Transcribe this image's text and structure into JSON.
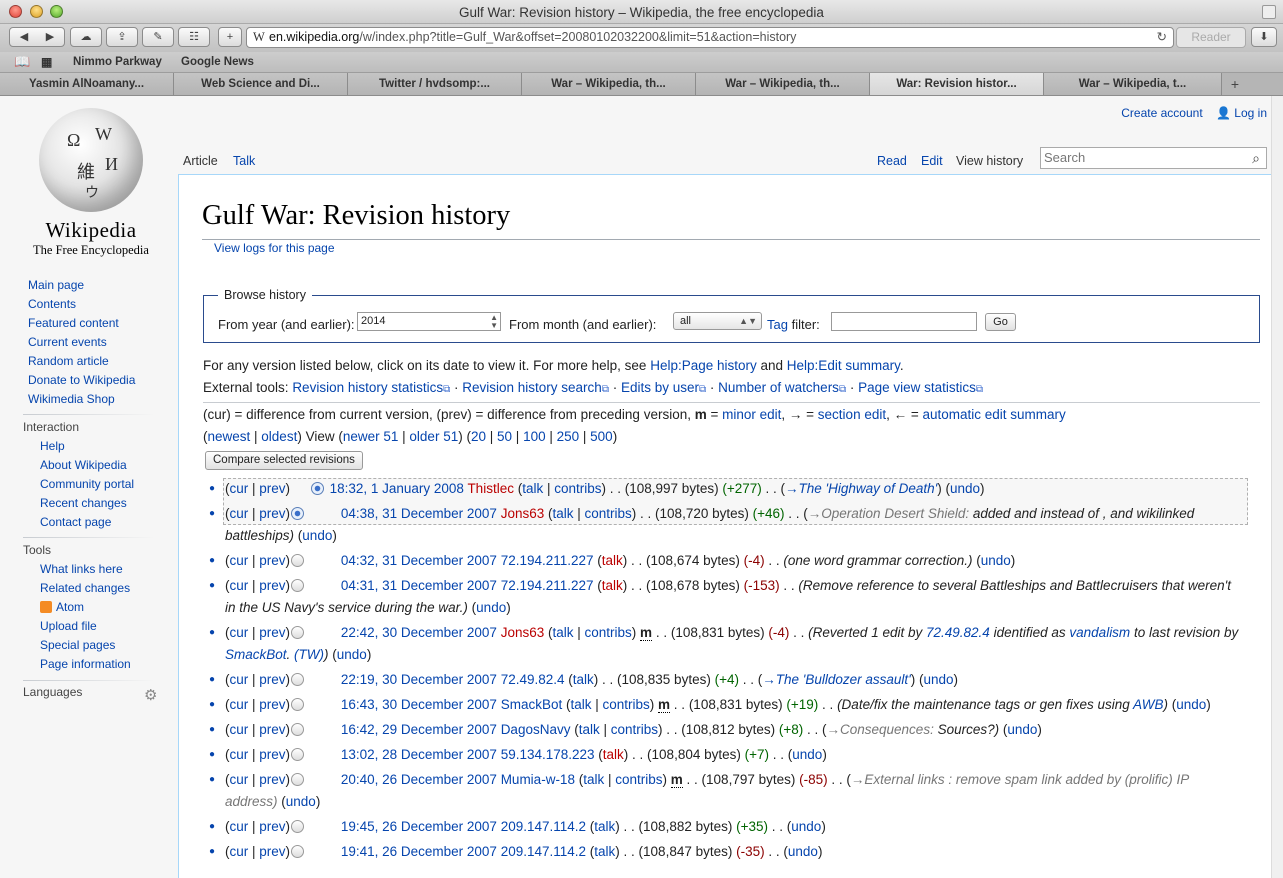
{
  "window": {
    "title": "Gulf War: Revision history – Wikipedia, the free encyclopedia"
  },
  "toolbar": {
    "url_host": "en.wikipedia.org",
    "url_path": "/w/index.php?title=Gulf_War&offset=20080102032200&limit=51&action=history",
    "reader_label": "Reader"
  },
  "bookmarks": [
    "Nimmo Parkway",
    "Google News"
  ],
  "tabs": [
    {
      "label": "Yasmin AlNoamany..."
    },
    {
      "label": "Web Science and Di..."
    },
    {
      "label": "Twitter / hvdsomp:..."
    },
    {
      "label": "War – Wikipedia, th..."
    },
    {
      "label": "War – Wikipedia, th..."
    },
    {
      "label": "War: Revision histor..."
    },
    {
      "label": "War – Wikipedia, t..."
    }
  ],
  "logo": {
    "title": "Wikipedia",
    "subtitle": "The Free Encyclopedia"
  },
  "personal": {
    "create": "Create account",
    "login": "Log in"
  },
  "nav": [
    "Main page",
    "Contents",
    "Featured content",
    "Current events",
    "Random article",
    "Donate to Wikipedia",
    "Wikimedia Shop"
  ],
  "interaction": {
    "heading": "Interaction",
    "items": [
      "Help",
      "About Wikipedia",
      "Community portal",
      "Recent changes",
      "Contact page"
    ]
  },
  "tools": {
    "heading": "Tools",
    "items": [
      "What links here",
      "Related changes",
      "Atom",
      "Upload file",
      "Special pages",
      "Page information"
    ]
  },
  "languages": {
    "heading": "Languages"
  },
  "ctabs": {
    "article": "Article",
    "talk": "Talk",
    "read": "Read",
    "edit": "Edit",
    "history": "View history"
  },
  "search": {
    "placeholder": "Search"
  },
  "heading": "Gulf War: Revision history",
  "viewlogs": "View logs for this page",
  "browse": {
    "legend": "Browse history",
    "year_label": "From year (and earlier):",
    "year_value": "2014",
    "month_label": "From month (and earlier):",
    "month_value": "all",
    "tag_link": "Tag",
    "tag_label": "filter:",
    "go": "Go"
  },
  "help": {
    "pre": "For any version listed below, click on its date to view it. For more help, see ",
    "link1": "Help:Page history",
    "mid": " and ",
    "link2": "Help:Edit summary",
    "post": "."
  },
  "external": {
    "label": "External tools:",
    "items": [
      "Revision history statistics",
      "Revision history search",
      "Edits by user",
      "Number of watchers",
      "Page view statistics"
    ]
  },
  "legend": {
    "a": "(cur) = difference from current version, (prev) = difference from preceding version, ",
    "m": "m",
    "eq": " = ",
    "minor": "minor edit",
    "arrow": ", → = ",
    "section": "section edit",
    "arrow2": ", ← = ",
    "auto": "automatic edit summary"
  },
  "paging": {
    "newest": "newest",
    "oldest": "oldest",
    "view": "View",
    "newer": "newer 51",
    "older": "older 51",
    "n20": "20",
    "n50": "50",
    "n100": "100",
    "n250": "250",
    "n500": "500"
  },
  "compare_label": "Compare selected revisions",
  "revisions": [
    {
      "cur": "cur",
      "prev": "prev",
      "date": "18:32, 1 January 2008",
      "user": "Thistlec",
      "talk": "talk",
      "contribs": "contribs",
      "bytes": "(108,997 bytes)",
      "diff": "(+277)",
      "comment": "→The 'Highway of Death'",
      "undo": "undo"
    },
    {
      "cur": "cur",
      "prev": "prev",
      "date": "04:38, 31 December 2007",
      "user": "Jons63",
      "talk": "talk",
      "contribs": "contribs",
      "bytes": "(108,720 bytes)",
      "diff": "(+46)",
      "comment_sec": "→Operation Desert Shield:",
      "comment": "added and instead of , and wikilinked",
      "comment2": "battleships)",
      "undo": "undo"
    },
    {
      "cur": "cur",
      "prev": "prev",
      "date": "04:32, 31 December 2007",
      "user": "72.194.211.227",
      "talk": "talk",
      "bytes": "(108,674 bytes)",
      "diff": "(-4)",
      "comment": "(one word grammar correction.)",
      "undo": "undo"
    },
    {
      "cur": "cur",
      "prev": "prev",
      "date": "04:31, 31 December 2007",
      "user": "72.194.211.227",
      "talk": "talk",
      "bytes": "(108,678 bytes)",
      "diff": "(-153)",
      "comment": "(Remove reference to several Battleships and Battlecruisers that weren't",
      "comment2": "in the US Navy's service during the war.)",
      "undo": "undo"
    },
    {
      "cur": "cur",
      "prev": "prev",
      "date": "22:42, 30 December 2007",
      "user": "Jons63",
      "talk": "talk",
      "contribs": "contribs",
      "minor": "m",
      "bytes": "(108,831 bytes)",
      "diff": "(-4)",
      "comment": "(Reverted 1 edit by",
      "ip": "72.49.82.4",
      "comment_mid": "identified as",
      "vandal": "vandalism",
      "comment_end": "to last revision by",
      "bot": "SmackBot",
      "tw": "(TW)",
      "undo": "undo"
    },
    {
      "cur": "cur",
      "prev": "prev",
      "date": "22:19, 30 December 2007",
      "user": "72.49.82.4",
      "talk": "talk",
      "bytes": "(108,835 bytes)",
      "diff": "(+4)",
      "comment": "→The 'Bulldozer assault'",
      "undo": "undo"
    },
    {
      "cur": "cur",
      "prev": "prev",
      "date": "16:43, 30 December 2007",
      "user": "SmackBot",
      "talk": "talk",
      "contribs": "contribs",
      "minor": "m",
      "bytes": "(108,831 bytes)",
      "diff": "(+19)",
      "comment": "(Date/fix the maintenance tags or gen fixes using",
      "awb": "AWB",
      "undo": "undo"
    },
    {
      "cur": "cur",
      "prev": "prev",
      "date": "16:42, 29 December 2007",
      "user": "DagosNavy",
      "talk": "talk",
      "contribs": "contribs",
      "bytes": "(108,812 bytes)",
      "diff": "(+8)",
      "comment_sec": "→Consequences:",
      "comment": "Sources?)",
      "undo": "undo"
    },
    {
      "cur": "cur",
      "prev": "prev",
      "date": "13:02, 28 December 2007",
      "user": "59.134.178.223",
      "talk": "talk",
      "bytes": "(108,804 bytes)",
      "diff": "(+7)",
      "undo": "undo"
    },
    {
      "cur": "cur",
      "prev": "prev",
      "date": "20:40, 26 December 2007",
      "user": "Mumia-w-18",
      "talk": "talk",
      "contribs": "contribs",
      "minor": "m",
      "bytes": "(108,797 bytes)",
      "diff": "(-85)",
      "comment_sec": "→External links : remove spam link added by (prolific) IP",
      "comment2": "address)",
      "undo": "undo"
    },
    {
      "cur": "cur",
      "prev": "prev",
      "date": "19:45, 26 December 2007",
      "user": "209.147.114.2",
      "talk": "talk",
      "bytes": "(108,882 bytes)",
      "diff": "(+35)",
      "undo": "undo"
    },
    {
      "cur": "cur",
      "prev": "prev",
      "date": "19:41, 26 December 2007",
      "user": "209.147.114.2",
      "talk": "talk",
      "bytes": "(108,847 bytes)",
      "diff": "(-35)",
      "undo": "undo"
    }
  ]
}
